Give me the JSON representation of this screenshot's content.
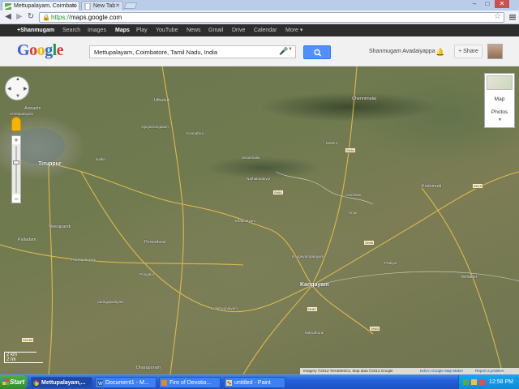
{
  "browser": {
    "tabs": [
      {
        "title": "Mettupalayam, Coimbato",
        "active": true
      },
      {
        "title": "New Tab",
        "active": false
      }
    ],
    "address": "https://maps.google.com",
    "address_scheme": "https://",
    "address_host": "maps.google.com"
  },
  "gbar": {
    "items": [
      "+Shanmugam",
      "Search",
      "Images",
      "Maps",
      "Play",
      "YouTube",
      "News",
      "Gmail",
      "Drive",
      "Calendar",
      "More ▾"
    ],
    "active": "Maps"
  },
  "header": {
    "logo": "Google",
    "search_query": "Mettupalayam, Coimbatore, Tamil Nadu, India",
    "user_name": "Shanmugam Avadaiyappa",
    "share_label": "+ Share"
  },
  "map": {
    "layers": {
      "map_label": "Map",
      "photos_label": "Photos"
    },
    "scale": {
      "metric": "2 km",
      "imperial": "2 mi"
    },
    "attribution": {
      "imagery": "Imagery ©2013 TerraMetrics, Map data ©2013 Google",
      "edit": "Edit in Google Map Maker",
      "report": "Report a problem"
    },
    "places": {
      "tiruppur": "Tiruppur",
      "kangayam": "Kangayam",
      "perundurai": "Perundurai",
      "vellakoil": "Vellakoil",
      "chennimalai": "Chennimalai",
      "palladam": "Palladam",
      "avinashi": "Avinashi",
      "veerapandi": "Veerapandi",
      "dharapuram": "Dharapuram",
      "uthukuli": "Uthukuli",
      "kodumudi": "Kodumudi",
      "muthur": "Muthur",
      "sivanmalai": "Sivanmalai",
      "nallur": "Nallur",
      "kunnathur": "Kunnathur",
      "vijayamangalam": "Vijayamangalam",
      "arachalur": "Arachalur",
      "nathakadaiyur": "Nathakadaiyur",
      "chettipalayam": "Chettipalayam",
      "pongalur": "Pongalur",
      "kolathupalayam": "Kolathupalayam",
      "kangeyampalayam": "Kangeyampalayam",
      "pachapalayam": "Pachapalayam",
      "marudhurai": "Marudhurai",
      "anjur": "Anjur",
      "ellapalayam": "Ellapalayam",
      "padiyur": "Padiyur",
      "vadugapalayam": "Vadugapalayam"
    },
    "shields": [
      "SH81",
      "SH84",
      "SH96",
      "SH19",
      "SH189",
      "NH67",
      "SH83"
    ]
  },
  "taskbar": {
    "start_label": "Start",
    "buttons": [
      {
        "label": "Mettupalayam,...",
        "active": true
      },
      {
        "label": "Document1 - M...",
        "active": false
      },
      {
        "label": "Fire of Devotio...",
        "active": false
      },
      {
        "label": "untitled - Paint",
        "active": false
      }
    ],
    "clock": "12:58 PM"
  },
  "colors": {
    "gbar_bg": "#2d2d2d",
    "search_button": "#4d90fe",
    "taskbar": "#245edb",
    "start_green": "#3c9a37",
    "map_terrain": "#707a4f"
  }
}
